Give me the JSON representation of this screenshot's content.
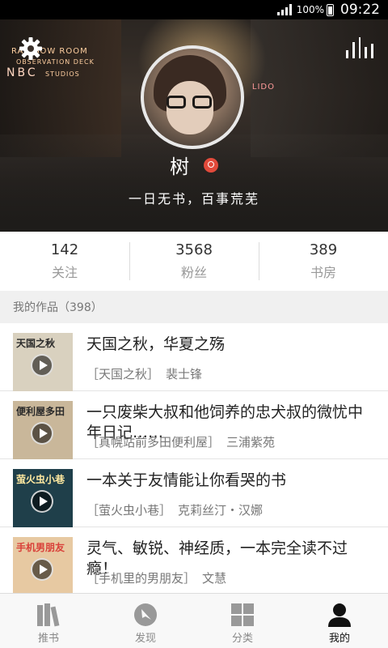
{
  "status_bar": {
    "battery_pct": "100%",
    "time": "09:22"
  },
  "header": {
    "sign_room": "RAINBOW ROOM",
    "sign_deck": "OBSERVATION DECK",
    "sign_nbc": "NBC",
    "sign_studios": "STUDIOS",
    "sign_lido": "LIDO",
    "username": "树",
    "motto": "一日无书，百事荒芜"
  },
  "stats": [
    {
      "value": "142",
      "label": "关注"
    },
    {
      "value": "3568",
      "label": "粉丝"
    },
    {
      "value": "389",
      "label": "书房"
    }
  ],
  "works": {
    "header": "我的作品（398）",
    "items": [
      {
        "title": "天国之秋，华夏之殇",
        "series": "［天国之秋］",
        "author": "裴士锋",
        "cover_text": "天国之秋",
        "cover_bg": "#d9d1bf"
      },
      {
        "title": "一只废柴大叔和他饲养的忠犬叔的微忧中年日记……",
        "series": "［真幌站前多田便利屋］",
        "author": "三浦紫苑",
        "cover_text": "便利屋多田",
        "cover_bg": "#c9b79a"
      },
      {
        "title": "一本关于友情能让你看哭的书",
        "series": "［萤火虫小巷］",
        "author": "克莉丝汀・汉娜",
        "cover_text": "萤火虫小巷",
        "cover_bg": "#1f3f4a"
      },
      {
        "title": "灵气、敏锐、神经质，一本完全读不过瘾！",
        "series": "［手机里的男朋友］",
        "author": "文慧",
        "cover_text": "手机男朋友",
        "cover_bg": "#e7c9a2"
      }
    ]
  },
  "tabs": [
    {
      "label": "推书",
      "icon": "books-icon",
      "active": false
    },
    {
      "label": "发现",
      "icon": "compass-icon",
      "active": false
    },
    {
      "label": "分类",
      "icon": "grid-icon",
      "active": false
    },
    {
      "label": "我的",
      "icon": "user-icon",
      "active": true
    }
  ],
  "colors": {
    "accent_badge": "#e24a3b",
    "active_tab": "#111111",
    "inactive_tab": "#888888"
  }
}
